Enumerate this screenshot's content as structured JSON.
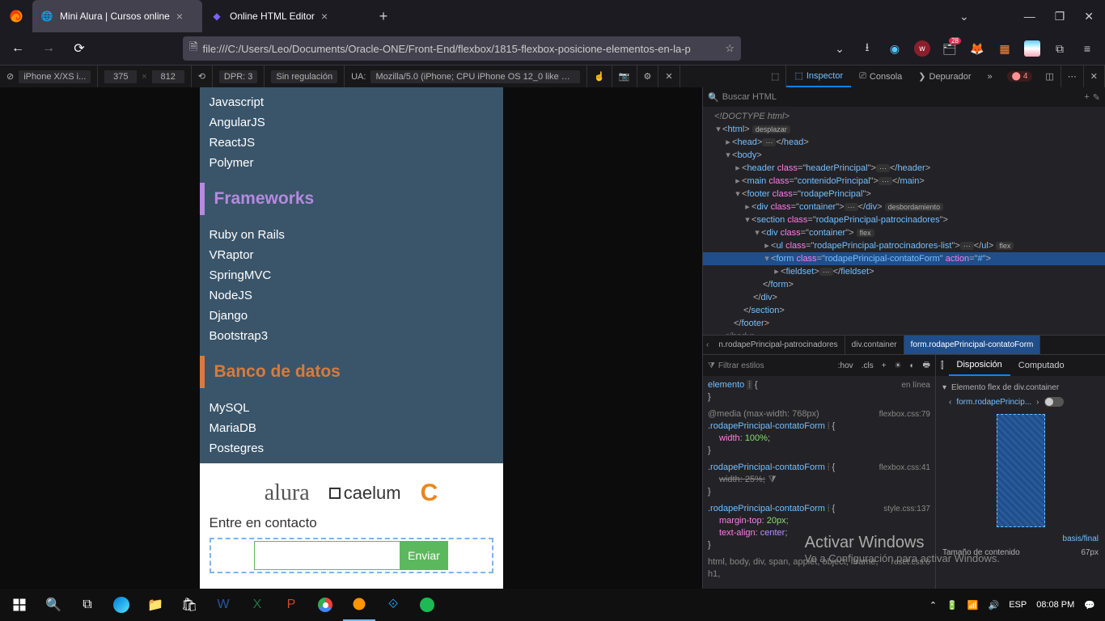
{
  "titlebar": {
    "tabs": [
      {
        "label": "Mini Alura | Cursos online",
        "active": true
      },
      {
        "label": "Online HTML Editor",
        "active": false
      }
    ]
  },
  "urlbar": {
    "url": "file:///C:/Users/Leo/Documents/Oracle-ONE/Front-End/flexbox/1815-flexbox-posicione-elementos-en-la-p",
    "toolbar_badge": "28"
  },
  "dt_toolbar": {
    "device": "iPhone X/XS i...",
    "width": "375",
    "height": "812",
    "dpr": "DPR: 3",
    "throttle": "Sin regulación",
    "ua_label": "UA:",
    "ua_value": "Mozilla/5.0 (iPhone; CPU iPhone OS 12_0 like Mac",
    "tab_inspector": "Inspector",
    "tab_console": "Consola",
    "tab_debugger": "Depurador",
    "error_count": "4"
  },
  "page": {
    "list_front": [
      "Javascript",
      "AngularJS",
      "ReactJS",
      "Polymer"
    ],
    "heading_frameworks": "Frameworks",
    "list_frameworks": [
      "Ruby on Rails",
      "VRaptor",
      "SpringMVC",
      "NodeJS",
      "Django",
      "Bootstrap3"
    ],
    "heading_db": "Banco de datos",
    "list_db": [
      "MySQL",
      "MariaDB",
      "Postegres"
    ],
    "sponsor1": "alura",
    "sponsor2": "caelum",
    "sponsor3": "C",
    "contact_label": "Entre en contacto",
    "submit": "Enviar"
  },
  "dom": {
    "search_placeholder": "Buscar HTML",
    "doctype": "<!DOCTYPE html>",
    "pill_scroll": "desplazar",
    "pill_overflow": "desbordamiento",
    "pill_flex": "flex"
  },
  "breadcrumb": {
    "b1": "n.rodapePrincipal-patrocinadores",
    "b2": "div.container",
    "b3": "form.rodapePrincipal-contatoForm"
  },
  "styles": {
    "filter": "Filtrar estilos",
    "hov": ":hov",
    "cls": ".cls",
    "r0_sel": "elemento",
    "r0_src": "en línea",
    "r1_media": "@media (max-width: 768px)",
    "r1_src": "flexbox.css:79",
    "r1_sel": ".rodapePrincipal-contatoForm",
    "r1_prop": "width",
    "r1_val": "100%",
    "r2_src": "flexbox.css:41",
    "r2_sel": ".rodapePrincipal-contatoForm",
    "r2_prop": "width",
    "r2_val": "25%",
    "r3_src": "style.css:137",
    "r3_sel": ".rodapePrincipal-contatoForm",
    "r3_p1": "margin-top",
    "r3_v1": "20px",
    "r3_p2": "text-align",
    "r3_v2": "center",
    "r4_src": "reset.css:6",
    "r4_sel": "html, body, div, span, applet, object, iframe, h1,"
  },
  "layout": {
    "tab1": "Disposición",
    "tab2": "Computado",
    "flex_title": "Elemento flex de div.container",
    "flex_item": "form.rodapePrincip...",
    "basis_link": "basis/final",
    "size_label": "Tamaño de contenido",
    "size_val": "67px"
  },
  "watermark": {
    "t1": "Activar Windows",
    "t2": "Ve a Configuración para activar Windows."
  },
  "taskbar": {
    "lang": "ESP",
    "time": "08:08 PM"
  }
}
